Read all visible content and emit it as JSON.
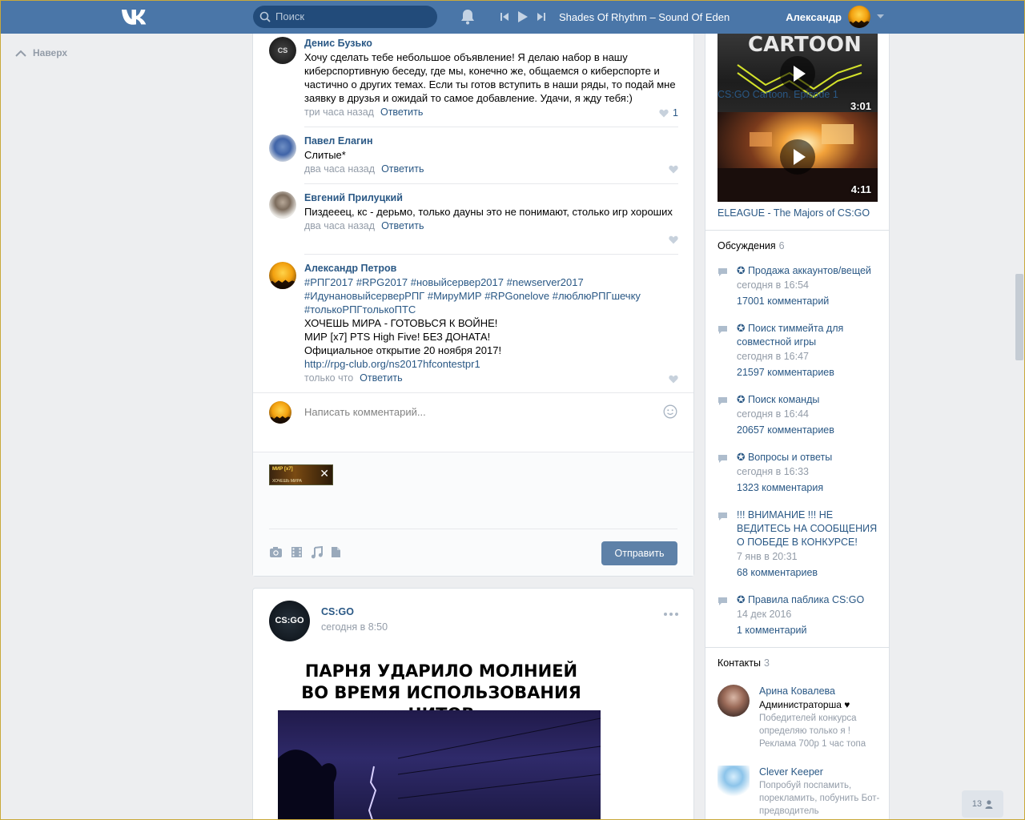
{
  "header": {
    "search_placeholder": "Поиск",
    "track": "Shades Of Rhythm – Sound Of Eden",
    "user_name": "Александр",
    "accent": "#4a76a8"
  },
  "left": {
    "up_label": "Наверх"
  },
  "comments": [
    {
      "author": "Денис Бузько",
      "text": "Хочу сделать тебе небольшое объявление! Я делаю набор в нашу киберспортивную беседу, где мы, конечно же, общаемся о киберспорте и частично о других темах. Если ты готов вступить в наши ряды, то подай мне заявку в друзья и ожидай то самое добавление. Удачи, я жду тебя:)",
      "time": "три часа назад",
      "reply": "Ответить",
      "likes": "1"
    },
    {
      "author": "Павел Елагин",
      "text": "Слитые*",
      "time": "два часа назад",
      "reply": "Ответить"
    },
    {
      "author": "Евгений Прилуцкий",
      "text": "Пиздееец, кс - дерьмо, только дауны это не понимают, столько игр хороших",
      "time": "два часа назад",
      "reply": "Ответить"
    },
    {
      "author": "Александр Петров",
      "lines": [
        "#РПГ2017 #RPG2017 #новыйсервер2017 #newserver2017",
        "#ИдунановыйсерверРПГ #МируМИР #RPGonelove #люблюРПГшечку",
        "#толькоРПГтолькоПТС",
        "ХОЧЕШЬ МИРА - ГОТОВЬСЯ К ВОЙНЕ!",
        "МИР [x7] PTS High Five! БЕЗ ДОНАТА!",
        "Официальное открытие 20 ноября 2017!",
        "http://rpg-club.org/ns2017hfcontestpr1"
      ],
      "time": "только что",
      "reply": "Ответить"
    }
  ],
  "composer": {
    "placeholder": "Написать комментарий...",
    "send_label": "Отправить"
  },
  "post": {
    "author": "CS:GO",
    "avatar_text": "CS:GO",
    "date": "сегодня в 8:50",
    "meme_line1": "ПАРНЯ УДАРИЛО МОЛНИЕЙ",
    "meme_line2": "ВО ВРЕМЯ ИСПОЛЬЗОВАНИЯ ЧИТОВ"
  },
  "videos": [
    {
      "title": "CS:GO Cartoon. Episode 1",
      "duration": "3:01"
    },
    {
      "title": "ELEAGUE - The Majors of CS:GO",
      "duration": "4:11"
    }
  ],
  "discussions": {
    "label": "Обсуждения",
    "count": "6",
    "topics": [
      {
        "title": "✪ Продажа аккаунтов/вещей",
        "date": "сегодня в 16:54",
        "comments": "17001 комментарий"
      },
      {
        "title": "✪ Поиск тиммейта для совместной игры",
        "date": "сегодня в 16:47",
        "comments": "21597 комментариев"
      },
      {
        "title": "✪ Поиск команды",
        "date": "сегодня в 16:44",
        "comments": "20657 комментариев"
      },
      {
        "title": "✪ Вопросы и ответы",
        "date": "сегодня в 16:33",
        "comments": "1323 комментария"
      },
      {
        "title": "!!! ВНИМАНИЕ !!! НЕ ВЕДИТЕСЬ НА СООБЩЕНИЯ О ПОБЕДЕ В КОНКУРСЕ!",
        "date": "7 янв в 20:31",
        "comments": "68 комментариев"
      },
      {
        "title": "✪ Правила паблика CS:GO",
        "date": "14 дек 2016",
        "comments": "1 комментарий"
      }
    ]
  },
  "contacts": {
    "label": "Контакты",
    "count": "3",
    "items": [
      {
        "name": "Арина Ковалева",
        "role": "Администраторша ♥",
        "desc": "Победителей конкурса определяю только я ! Реклама 700р 1 час топа"
      },
      {
        "name": "Clever Keeper",
        "desc": "Попробуй поспамить, порекламить, побунить Бот-предводитель"
      }
    ]
  },
  "online_count": "13"
}
